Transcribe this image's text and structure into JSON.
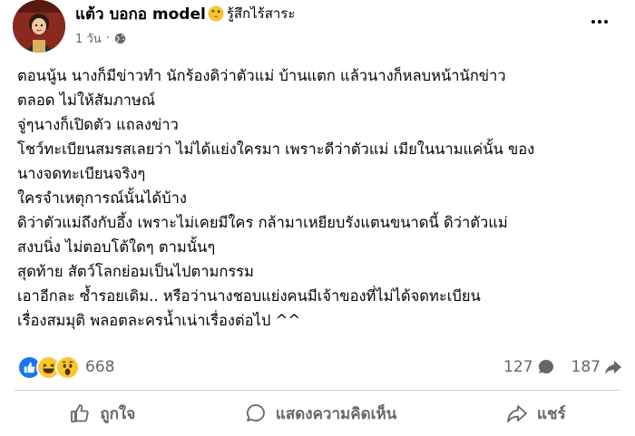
{
  "post": {
    "author": "แต้ว บอกอ model",
    "feeling": "รู้สึกไร้สาระ",
    "time": "1 วัน",
    "meta_separator": "·",
    "icons": {
      "avatar": "profile-avatar",
      "feeling_emoji": "dizzy-face-emoji",
      "privacy": "globe-icon",
      "more": "more-horizontal-icon"
    },
    "text_lines": [
      "ตอนนู้น นางก็มีข่าวทำ นักร้องดิว่าตัวแม่ บ้านแตก แล้วนางก็หลบหน้านักข่าว",
      "ตลอด ไม่ให้สัมภาษณ์",
      "จู่ๆนางก็เปิดตัว แถลงข่าว",
      "โชว์ทะเบียนสมรสเลยว่า ไม่ได้แย่งใครมา เพราะดีว่าตัวแม่ เมียในนามแค่นั้น ของ",
      "นางจดทะเบียนจริงๆ",
      "ใครจำเหตุการณ์นั้นได้บ้าง",
      "ดิว่าตัวแม่ถึงกับอึ้ง เพราะไม่เคยมีใคร กล้ามาเหยียบรังแตนขนาดนี้ ดิว่าตัวแม่",
      "สงบนิ่ง ไม่ตอบโต้ใดๆ ตามนั้นๆ",
      "สุดท้าย สัตว์โลกย่อมเป็นไปตามกรรม",
      "เอาอีกละ ซ้ำรอยเดิม.. หรือว่านางชอบแย่งคนมีเจ้าของที่ไม่ได้จดทะเบียน",
      "เรื่องสมมุติ  พลอตละครน้ำเน่าเรื่องต่อไป  ^^"
    ]
  },
  "engagement": {
    "reaction_icons": [
      "like-reaction-icon",
      "haha-reaction-icon",
      "wow-reaction-icon"
    ],
    "reaction_count": "668",
    "comment_count": "127",
    "share_count": "187"
  },
  "actions": {
    "like_label": "ถูกใจ",
    "comment_label": "แสดงความคิดเห็น",
    "share_label": "แชร์"
  },
  "colors": {
    "text": "#050505",
    "secondary": "#65676b",
    "like_blue": "#1877f2",
    "divider": "#ced0d4"
  }
}
